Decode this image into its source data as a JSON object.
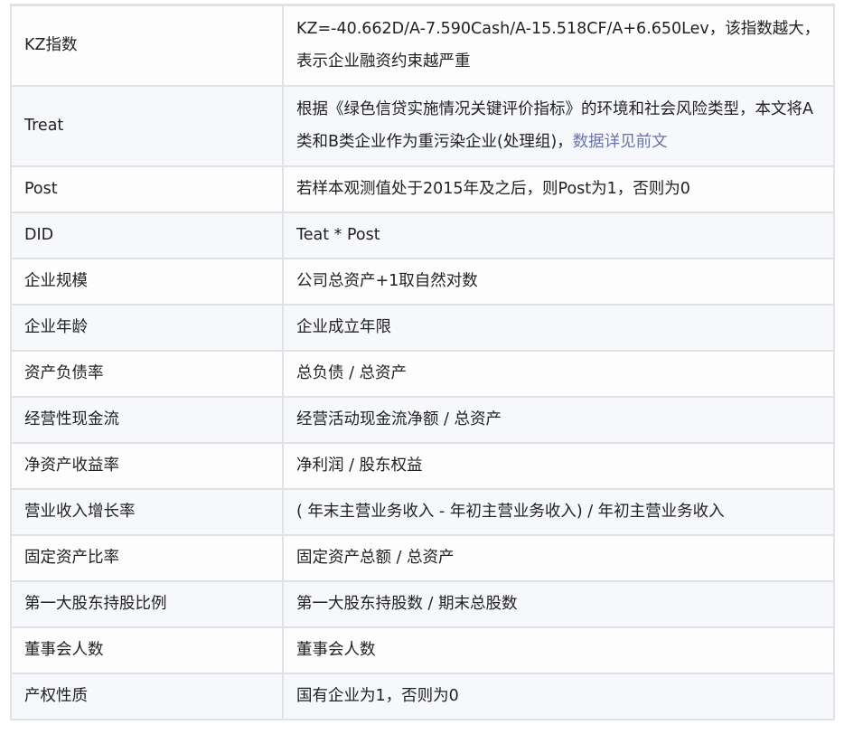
{
  "table": {
    "rows": [
      {
        "name": "KZ指数",
        "definition": "KZ=-40.662D/A-7.590Cash/A-15.518CF/A+6.650Lev，该指数越大，表示企业融资约束越严重",
        "link": ""
      },
      {
        "name": "Treat",
        "definition": "根据《绿色信贷实施情况关键评价指标》的环境和社会风险类型，本文将A  类和B类企业作为重污染企业(处理组)，",
        "link": "数据详见前文"
      },
      {
        "name": "Post",
        "definition": "若样本观测值处于2015年及之后，则Post为1，否则为0",
        "link": ""
      },
      {
        "name": "DID",
        "definition": "Teat * Post",
        "link": ""
      },
      {
        "name": "企业规模",
        "definition": "公司总资产+1取自然对数",
        "link": ""
      },
      {
        "name": "企业年龄",
        "definition": "企业成立年限",
        "link": ""
      },
      {
        "name": "资产负债率",
        "definition": "总负债 /  总资产",
        "link": ""
      },
      {
        "name": "经营性现金流",
        "definition": "经营活动现金流净额 /  总资产",
        "link": ""
      },
      {
        "name": "净资产收益率",
        "definition": "净利润 /  股东权益",
        "link": ""
      },
      {
        "name": "营业收入增长率",
        "definition": "( 年末主营业务收入 - 年初主营业务收入) / 年初主营业务收入",
        "link": ""
      },
      {
        "name": "固定资产比率",
        "definition": "固定资产总额 /  总资产",
        "link": ""
      },
      {
        "name": "第一大股东持股比例",
        "definition": "第一大股东持股数 /  期末总股数",
        "link": ""
      },
      {
        "name": "董事会人数",
        "definition": "董事会人数",
        "link": ""
      },
      {
        "name": "产权性质",
        "definition": "国有企业为1，否则为0",
        "link": ""
      }
    ]
  }
}
